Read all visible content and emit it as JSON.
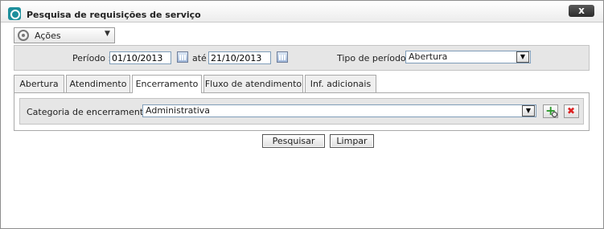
{
  "window": {
    "title": "Pesquisa de requisições de serviço",
    "close_label": "x"
  },
  "actions": {
    "label": "Ações"
  },
  "filters": {
    "period_label": "Período :",
    "period_start": "01/10/2013",
    "until_label": "até",
    "period_end": "21/10/2013",
    "period_type_label": "Tipo de período :",
    "period_type_value": "Abertura"
  },
  "tabs": [
    {
      "label": "Abertura"
    },
    {
      "label": "Atendimento"
    },
    {
      "label": "Encerramento"
    },
    {
      "label": "Fluxo de atendimento"
    },
    {
      "label": "Inf. adicionais"
    }
  ],
  "active_tab": "Encerramento",
  "closing": {
    "category_label": "Categoria de encerramento :",
    "category_value": "Administrativa"
  },
  "buttons": {
    "search": "Pesquisar",
    "clear": "Limpar"
  }
}
